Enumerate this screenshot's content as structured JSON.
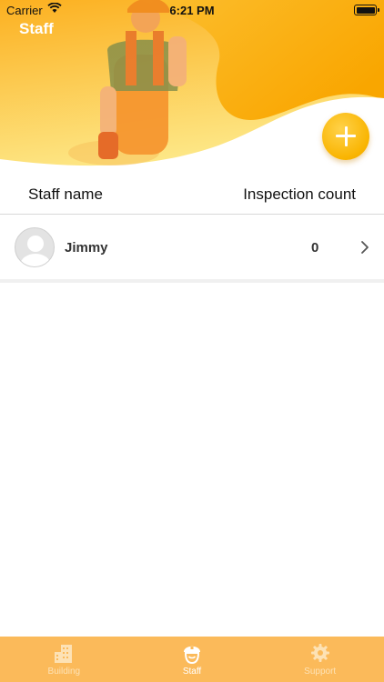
{
  "status_bar": {
    "carrier": "Carrier",
    "time": "6:21 PM"
  },
  "header": {
    "title": "Staff",
    "add_icon": "plus-icon"
  },
  "table": {
    "columns": {
      "name": "Staff name",
      "count": "Inspection count"
    },
    "rows": [
      {
        "name": "Jimmy",
        "count": "0",
        "avatar_icon": "user-avatar-icon"
      }
    ]
  },
  "tab_bar": {
    "tabs": [
      {
        "label": "Building",
        "icon": "building-icon",
        "active": false
      },
      {
        "label": "Staff",
        "icon": "worker-helmet-icon",
        "active": true
      },
      {
        "label": "Support",
        "icon": "gear-icon",
        "active": false
      }
    ]
  },
  "colors": {
    "accent": "#f9b400",
    "tab_bar": "#fbba5a",
    "header_light": "#fde27a"
  }
}
